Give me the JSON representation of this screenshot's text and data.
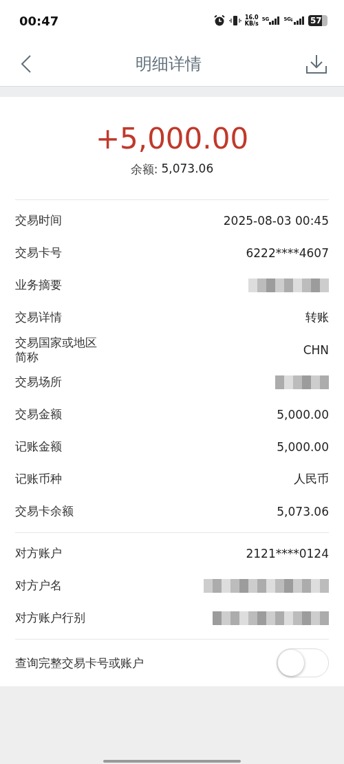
{
  "status_bar": {
    "time": "00:47",
    "speed": "16.0",
    "speed_unit": "KB/s",
    "sim_1": "5G",
    "sim_2": "5G",
    "battery": "57"
  },
  "header": {
    "title": "明细详情"
  },
  "summary": {
    "amount": "+5,000.00",
    "balance_label": "余额:",
    "balance": "5,073.06"
  },
  "sections": [
    {
      "rows": [
        {
          "label": "交易时间",
          "kind": "text",
          "value": "2025-08-03 00:45"
        },
        {
          "label": "交易卡号",
          "kind": "text",
          "value": "6222****4607"
        },
        {
          "label": "业务摘要",
          "kind": "redacted"
        },
        {
          "label": "交易详情",
          "kind": "text",
          "value": "转账"
        },
        {
          "label": "交易国家或地区简称",
          "kind": "text",
          "value": "CHN"
        },
        {
          "label": "交易场所",
          "kind": "redacted"
        },
        {
          "label": "交易金额",
          "kind": "text",
          "value": "5,000.00"
        },
        {
          "label": "记账金额",
          "kind": "text",
          "value": "5,000.00"
        },
        {
          "label": "记账币种",
          "kind": "text",
          "value": "人民币"
        },
        {
          "label": "交易卡余额",
          "kind": "text",
          "value": "5,073.06"
        }
      ]
    },
    {
      "rows": [
        {
          "label": "对方账户",
          "kind": "text",
          "value": "2121****0124"
        },
        {
          "label": "对方户名",
          "kind": "redacted"
        },
        {
          "label": "对方账户行别",
          "kind": "redacted"
        }
      ]
    }
  ],
  "toggle": {
    "label": "查询完整交易卡号或账户",
    "on": false
  }
}
